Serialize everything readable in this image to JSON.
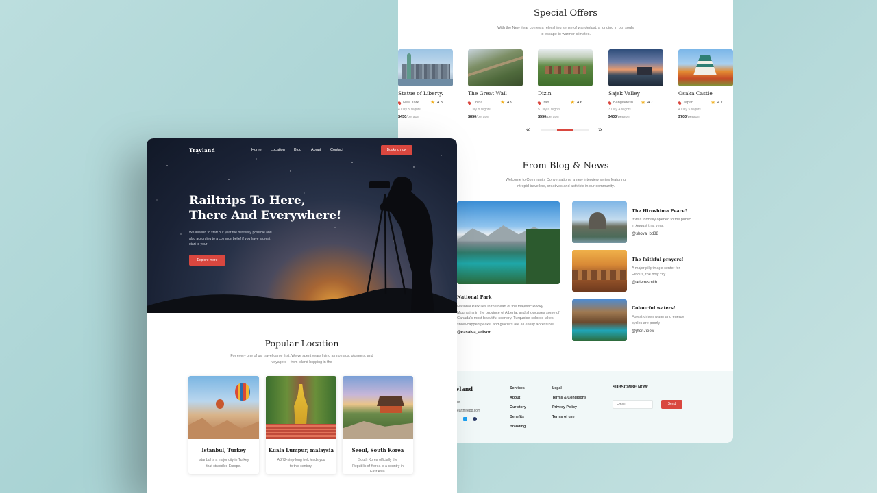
{
  "front": {
    "logo": "Travland",
    "nav": [
      "Home",
      "Location",
      "Blog",
      "About",
      "Contact"
    ],
    "booking_button": "Booking now",
    "hero_title_line1": "Railtrips To Here,",
    "hero_title_line2": "There And Everywhere!",
    "hero_desc": "We all wish to start our year the best way possible and also according to a common belief if you have a great start to your",
    "explore_button": "Explore more",
    "popular_title": "Popular Location",
    "popular_sub_line1": "For every one of us, travel came first. We've spent years living as nomads, pioneers, and",
    "popular_sub_line2": "voyagers – from island hopping in the",
    "locations": [
      {
        "name": "Istanbul, Turkey",
        "desc": "Istanbul is a major city in Turkey that straddles Europe."
      },
      {
        "name": "Kuala Lumpur, malaysia",
        "desc": "A 272-step-long trek leads you to this century."
      },
      {
        "name": "Seoul, South Korea",
        "desc": "South Korea officially the Republic of Korea is a country in East Asia."
      }
    ]
  },
  "back": {
    "offers_title": "Special Offers",
    "offers_sub_line1": "With the New Year comes a refreshing sense of wanderlust, a longing in our souls",
    "offers_sub_line2": "to escape to warmer climates.",
    "offers": [
      {
        "name": "Statue of Liberty.",
        "location": "New York",
        "rating": "4.8",
        "nights": "4 Day 5 Nights",
        "price": "$450",
        "per": "/person"
      },
      {
        "name": "The Great Wall",
        "location": "China",
        "rating": "4.9",
        "nights": "7 Day 8 Nights",
        "price": "$850",
        "per": "/person"
      },
      {
        "name": "Dizin",
        "location": "Iran",
        "rating": "4.6",
        "nights": "5 Day 6 Nights",
        "price": "$550",
        "per": "/person"
      },
      {
        "name": "Sajek Valley",
        "location": "Bangladesh",
        "rating": "4.7",
        "nights": "3 Day 4 Nights",
        "price": "$400",
        "per": "/person"
      },
      {
        "name": "Osaka Castle",
        "location": "Japan",
        "rating": "4.7",
        "nights": "4 Day 5 Nights",
        "price": "$700",
        "per": "/person"
      }
    ],
    "prev_arrow": "«",
    "next_arrow": "»",
    "blog_title": "From Blog & News",
    "blog_sub_line1": "Welcome to Community Conversations, a new interview series featuring",
    "blog_sub_line2": "intrepid travellers, creatives and activists in our community.",
    "main_post": {
      "title": "National Park",
      "desc": "National Park lies in the heart of the majestic Rocky Mountains in the province of Alberta, and showcases some of Canada's most beautiful scenery. Turquoise-colored lakes, snow-capped peaks, and glaciers are all easily accessible",
      "author": "@casalva_adison"
    },
    "side_posts": [
      {
        "title": "The Hiroshima Peace!",
        "desc": "It was formally opened to the public in August that year.",
        "author": "@shova_bd88"
      },
      {
        "title": "The faithful prayers!",
        "desc": "A major pilgrimage center for Hindus, the holy city.",
        "author": "@adem/smith"
      },
      {
        "title": "Colourful waters!",
        "desc": "Forest-driven water and energy cycles are poorly",
        "author": "@jhon7ieew"
      }
    ],
    "footer": {
      "logo": "Travland",
      "contact_line1": "us",
      "contact_email": "earthlife88.com",
      "col1": [
        "Services",
        "About",
        "Our story",
        "Benefits",
        "Branding"
      ],
      "col2": [
        "Legal",
        "Terms & Conditions",
        "Privecy Policy",
        "Terms of use"
      ],
      "subscribe_title": "SUBSCRIBE NOW",
      "email_placeholder": "Email",
      "send_button": "Send"
    }
  }
}
